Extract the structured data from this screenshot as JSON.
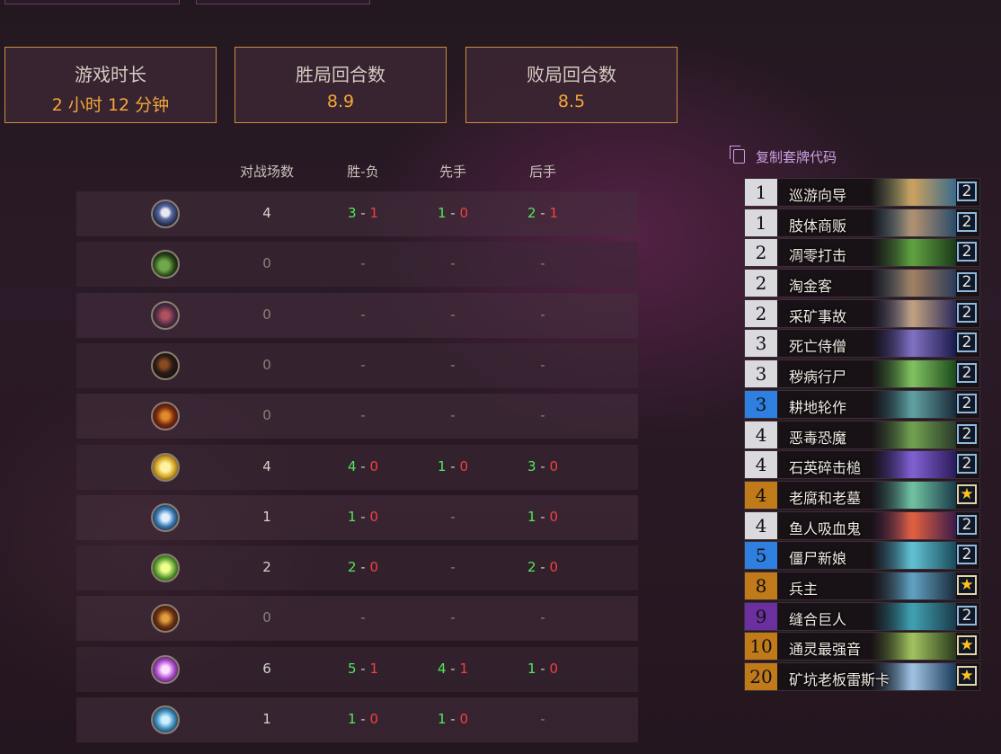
{
  "stats": [
    {
      "label": "游戏时长",
      "value": "2 小时 12 分钟"
    },
    {
      "label": "胜局回合数",
      "value": "8.9"
    },
    {
      "label": "败局回合数",
      "value": "8.5"
    }
  ],
  "table": {
    "headers": {
      "games": "对战场数",
      "wl": "胜-负",
      "first": "先手",
      "second": "后手"
    },
    "rows": [
      {
        "icon": "paladin-class-icon",
        "games": "4",
        "wl": [
          "3",
          "1"
        ],
        "first": [
          "1",
          "0"
        ],
        "second": [
          "2",
          "1"
        ]
      },
      {
        "icon": "druid-class-icon",
        "games": "0",
        "wl": null,
        "first": null,
        "second": null
      },
      {
        "icon": "hunter-class-icon",
        "games": "0",
        "wl": null,
        "first": null,
        "second": null
      },
      {
        "icon": "rogue-class-icon",
        "games": "0",
        "wl": null,
        "first": null,
        "second": null
      },
      {
        "icon": "warlock-class-icon",
        "games": "0",
        "wl": null,
        "first": null,
        "second": null
      },
      {
        "icon": "priest-class-icon",
        "games": "4",
        "wl": [
          "4",
          "0"
        ],
        "first": [
          "1",
          "0"
        ],
        "second": [
          "3",
          "0"
        ]
      },
      {
        "icon": "mage-class-icon",
        "games": "1",
        "wl": [
          "1",
          "0"
        ],
        "first": null,
        "second": [
          "1",
          "0"
        ]
      },
      {
        "icon": "shaman-class-icon",
        "games": "2",
        "wl": [
          "2",
          "0"
        ],
        "first": null,
        "second": [
          "2",
          "0"
        ]
      },
      {
        "icon": "warrior-class-icon",
        "games": "0",
        "wl": null,
        "first": null,
        "second": null
      },
      {
        "icon": "demon-hunter-class-icon",
        "games": "6",
        "wl": [
          "5",
          "1"
        ],
        "first": [
          "4",
          "1"
        ],
        "second": [
          "1",
          "0"
        ]
      },
      {
        "icon": "death-knight-class-icon",
        "games": "1",
        "wl": [
          "1",
          "0"
        ],
        "first": [
          "1",
          "0"
        ],
        "second": null
      }
    ],
    "dash": "-",
    "sep": " - "
  },
  "deck": {
    "copy_label": "复制套牌代码",
    "cards": [
      {
        "cost": "1",
        "name": "巡游向导",
        "count": "2",
        "rarity": "common"
      },
      {
        "cost": "1",
        "name": "肢体商贩",
        "count": "2",
        "rarity": "common"
      },
      {
        "cost": "2",
        "name": "凋零打击",
        "count": "2",
        "rarity": "common"
      },
      {
        "cost": "2",
        "name": "淘金客",
        "count": "2",
        "rarity": "common"
      },
      {
        "cost": "2",
        "name": "采矿事故",
        "count": "2",
        "rarity": "common"
      },
      {
        "cost": "3",
        "name": "死亡侍僧",
        "count": "2",
        "rarity": "common"
      },
      {
        "cost": "3",
        "name": "秽病行尸",
        "count": "2",
        "rarity": "common"
      },
      {
        "cost": "3",
        "name": "耕地轮作",
        "count": "2",
        "rarity": "rare"
      },
      {
        "cost": "4",
        "name": "恶毒恐魔",
        "count": "2",
        "rarity": "common"
      },
      {
        "cost": "4",
        "name": "石英碎击槌",
        "count": "2",
        "rarity": "common"
      },
      {
        "cost": "4",
        "name": "老腐和老墓",
        "count": "★",
        "rarity": "legendary"
      },
      {
        "cost": "4",
        "name": "鱼人吸血鬼",
        "count": "2",
        "rarity": "common"
      },
      {
        "cost": "5",
        "name": "僵尸新娘",
        "count": "2",
        "rarity": "rare"
      },
      {
        "cost": "8",
        "name": "兵主",
        "count": "★",
        "rarity": "legendary"
      },
      {
        "cost": "9",
        "name": "缝合巨人",
        "count": "2",
        "rarity": "epic"
      },
      {
        "cost": "10",
        "name": "通灵最强音",
        "count": "★",
        "rarity": "legendary"
      },
      {
        "cost": "20",
        "name": "矿坑老板雷斯卡",
        "count": "★",
        "rarity": "legendary"
      }
    ]
  },
  "colors": {
    "accent": "#f3a73a",
    "win": "#4fe85a",
    "loss": "#f0413e",
    "link": "#c9a0e0"
  }
}
